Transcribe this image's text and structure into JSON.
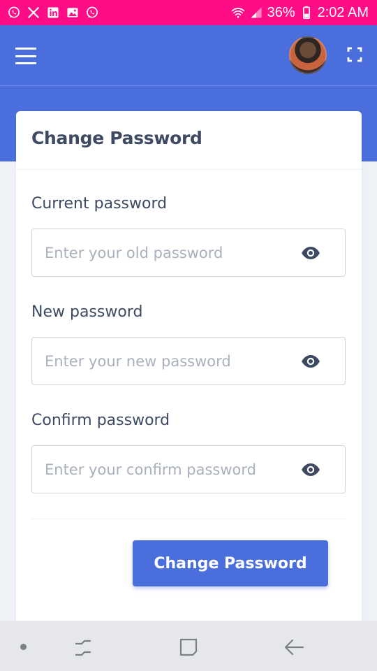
{
  "status_bar": {
    "notification_icons": [
      "whatsapp-icon",
      "x-icon",
      "linkedin-icon",
      "gallery-icon",
      "whatsapp-icon"
    ],
    "battery": "36%",
    "time": "2:02 AM",
    "background_color": "#ff0d86"
  },
  "header": {
    "menu_icon": "hamburger-menu-icon",
    "fullscreen_icon": "fullscreen-icon",
    "background_color": "#4a6fdd"
  },
  "form": {
    "title": "Change Password",
    "fields": [
      {
        "label": "Current password",
        "placeholder": "Enter your old password",
        "value": ""
      },
      {
        "label": "New password",
        "placeholder": "Enter your new password",
        "value": ""
      },
      {
        "label": "Confirm password",
        "placeholder": "Enter your confirm password",
        "value": ""
      }
    ],
    "toggle_icon": "eye-icon",
    "submit_label": "Change Password",
    "accent_color": "#4a6fdd"
  },
  "nav_bar": {
    "icons": [
      "dot-icon",
      "recents-icon",
      "home-icon",
      "back-icon"
    ]
  }
}
